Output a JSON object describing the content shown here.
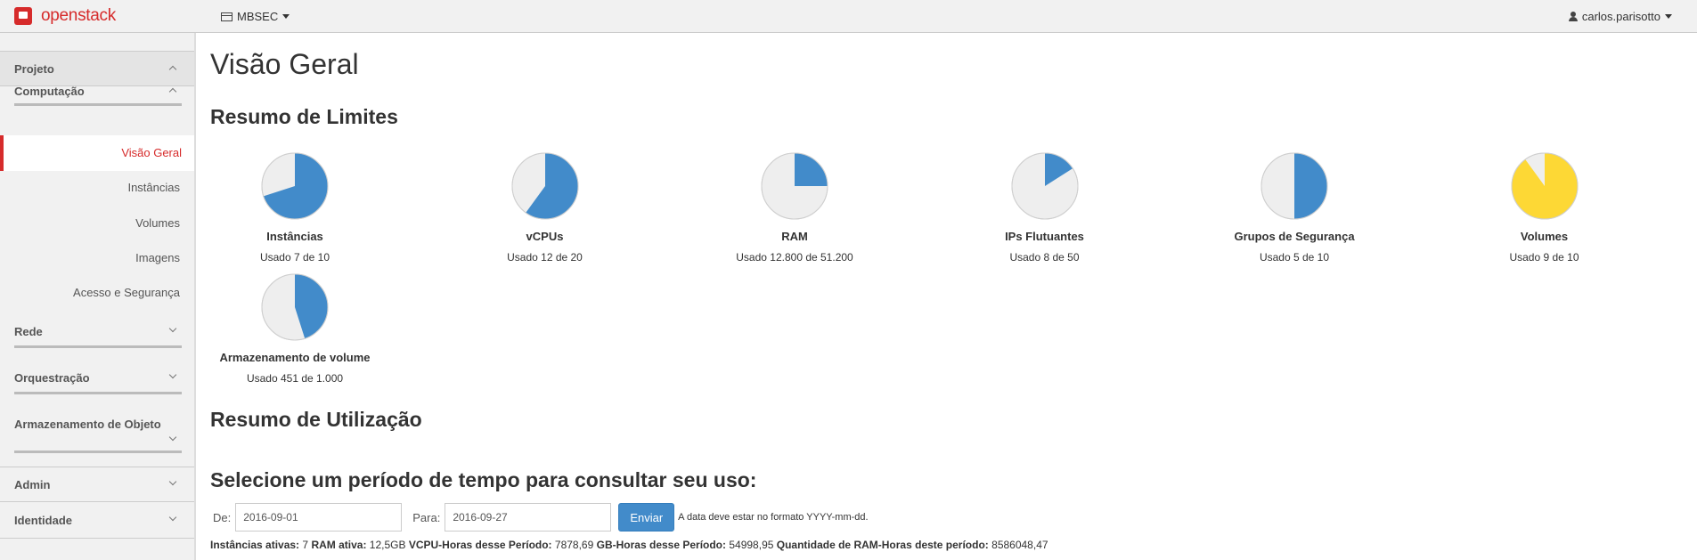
{
  "topbar": {
    "brand": "openstack",
    "project": "MBSEC",
    "user": "carlos.parisotto"
  },
  "sidebar": {
    "project": "Projeto",
    "compute": "Computação",
    "items": {
      "overview": "Visão Geral",
      "instances": "Instâncias",
      "volumes": "Volumes",
      "images": "Imagens",
      "access": "Acesso e Segurança"
    },
    "network": "Rede",
    "orchestration": "Orquestração",
    "object_storage": "Armazenamento de Objeto",
    "admin": "Admin",
    "identity": "Identidade"
  },
  "main": {
    "title": "Visão Geral",
    "limits_title": "Resumo de Limites",
    "usage_title": "Resumo de Utilização",
    "period_title": "Selecione um período de tempo para consultar seu uso:",
    "form": {
      "from_label": "De:",
      "from_value": "2016-09-01",
      "to_label": "Para:",
      "to_value": "2016-09-27",
      "submit": "Enviar",
      "hint": "A data deve estar no formato YYYY-mm-dd."
    },
    "summary": {
      "active_instances_label": "Instâncias ativas:",
      "active_instances": "7",
      "ram_label": "RAM ativa:",
      "ram": "12,5GB",
      "vcpu_label": "VCPU-Horas desse Período:",
      "vcpu": "7878,69",
      "gb_label": "GB-Horas desse Período:",
      "gb": "54998,95",
      "ramh_label": "Quantidade de RAM-Horas deste período:",
      "ramh": "8586048,47"
    }
  },
  "colors": {
    "normal": "#428bca",
    "warning": "#fdd835",
    "empty": "#eeeeee",
    "accent": "#d62b2b"
  },
  "chart_data": {
    "type": "pie",
    "charts": [
      {
        "label": "Instâncias",
        "used": 7,
        "total": 10,
        "usage_text": "Usado 7 de 10"
      },
      {
        "label": "vCPUs",
        "used": 12,
        "total": 20,
        "usage_text": "Usado 12 de 20"
      },
      {
        "label": "RAM",
        "used": 12800,
        "total": 51200,
        "usage_text": "Usado 12.800 de 51.200"
      },
      {
        "label": "IPs Flutuantes",
        "used": 8,
        "total": 50,
        "usage_text": "Usado 8 de 50"
      },
      {
        "label": "Grupos de Segurança",
        "used": 5,
        "total": 10,
        "usage_text": "Usado 5 de 10"
      },
      {
        "label": "Volumes",
        "used": 9,
        "total": 10,
        "usage_text": "Usado 9 de 10",
        "color": "warning"
      },
      {
        "label": "Armazenamento de volume",
        "used": 451,
        "total": 1000,
        "usage_text": "Usado 451 de 1.000"
      }
    ]
  }
}
